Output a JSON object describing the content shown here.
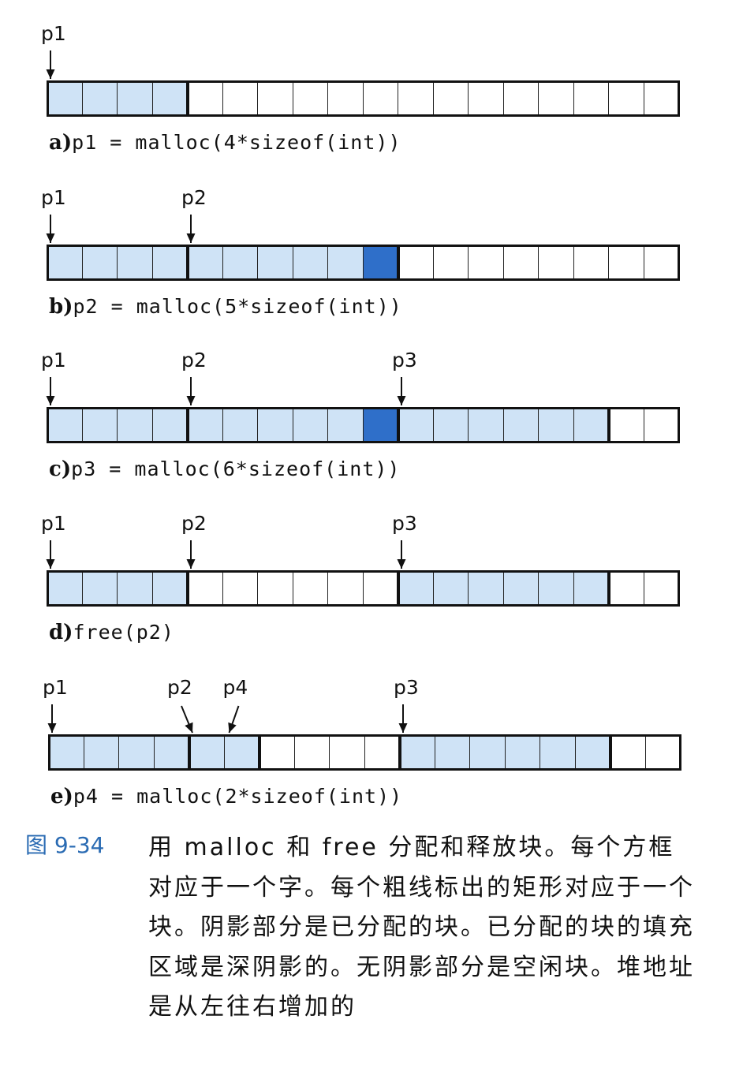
{
  "panels": [
    {
      "tag": "a)",
      "code": "p1 = malloc(4*sizeof(int))",
      "pointers": [
        {
          "label": "p1",
          "word": 0
        }
      ],
      "words": [
        "alloc",
        "alloc",
        "alloc",
        "alloc",
        "free",
        "free",
        "free",
        "free",
        "free",
        "free",
        "free",
        "free",
        "free",
        "free",
        "free",
        "free",
        "free",
        "free"
      ],
      "blocks": [
        {
          "start": 0,
          "len": 4
        },
        {
          "start": 4,
          "len": 14
        }
      ]
    },
    {
      "tag": "b)",
      "code": "p2 = malloc(5*sizeof(int))",
      "pointers": [
        {
          "label": "p1",
          "word": 0
        },
        {
          "label": "p2",
          "word": 4
        }
      ],
      "words": [
        "alloc",
        "alloc",
        "alloc",
        "alloc",
        "alloc",
        "alloc",
        "alloc",
        "alloc",
        "alloc",
        "pad",
        "free",
        "free",
        "free",
        "free",
        "free",
        "free",
        "free",
        "free"
      ],
      "blocks": [
        {
          "start": 0,
          "len": 4
        },
        {
          "start": 4,
          "len": 6
        },
        {
          "start": 10,
          "len": 8
        }
      ]
    },
    {
      "tag": "c)",
      "code": "p3 = malloc(6*sizeof(int))",
      "pointers": [
        {
          "label": "p1",
          "word": 0
        },
        {
          "label": "p2",
          "word": 4
        },
        {
          "label": "p3",
          "word": 10
        }
      ],
      "words": [
        "alloc",
        "alloc",
        "alloc",
        "alloc",
        "alloc",
        "alloc",
        "alloc",
        "alloc",
        "alloc",
        "pad",
        "alloc",
        "alloc",
        "alloc",
        "alloc",
        "alloc",
        "alloc",
        "free",
        "free"
      ],
      "blocks": [
        {
          "start": 0,
          "len": 4
        },
        {
          "start": 4,
          "len": 6
        },
        {
          "start": 10,
          "len": 6
        },
        {
          "start": 16,
          "len": 2
        }
      ]
    },
    {
      "tag": "d)",
      "code": "free(p2)",
      "pointers": [
        {
          "label": "p1",
          "word": 0
        },
        {
          "label": "p2",
          "word": 4
        },
        {
          "label": "p3",
          "word": 10
        }
      ],
      "words": [
        "alloc",
        "alloc",
        "alloc",
        "alloc",
        "free",
        "free",
        "free",
        "free",
        "free",
        "free",
        "alloc",
        "alloc",
        "alloc",
        "alloc",
        "alloc",
        "alloc",
        "free",
        "free"
      ],
      "blocks": [
        {
          "start": 0,
          "len": 4
        },
        {
          "start": 4,
          "len": 6
        },
        {
          "start": 10,
          "len": 6
        },
        {
          "start": 16,
          "len": 2
        }
      ]
    },
    {
      "tag": "e)",
      "code": "p4 = malloc(2*sizeof(int))",
      "pointers": [
        {
          "label": "p1",
          "word": 0
        },
        {
          "label": "p2",
          "word": 4,
          "diagonal": true
        },
        {
          "label": "p4",
          "word": 4,
          "diagonal": true,
          "labelShift": 1
        },
        {
          "label": "p3",
          "word": 10
        }
      ],
      "words": [
        "alloc",
        "alloc",
        "alloc",
        "alloc",
        "alloc",
        "alloc",
        "free",
        "free",
        "free",
        "free",
        "alloc",
        "alloc",
        "alloc",
        "alloc",
        "alloc",
        "alloc",
        "free",
        "free"
      ],
      "blocks": [
        {
          "start": 0,
          "len": 4
        },
        {
          "start": 4,
          "len": 2
        },
        {
          "start": 6,
          "len": 4
        },
        {
          "start": 10,
          "len": 6
        },
        {
          "start": 16,
          "len": 2
        }
      ]
    }
  ],
  "caption": {
    "number": "图 9-34",
    "text": "用 malloc 和 free 分配和释放块。每个方框对应于一个字。每个粗线标出的矩形对应于一个块。阴影部分是已分配的块。已分配的块的填充区域是深阴影的。无阴影部分是空闲块。堆地址是从左往右增加的"
  }
}
